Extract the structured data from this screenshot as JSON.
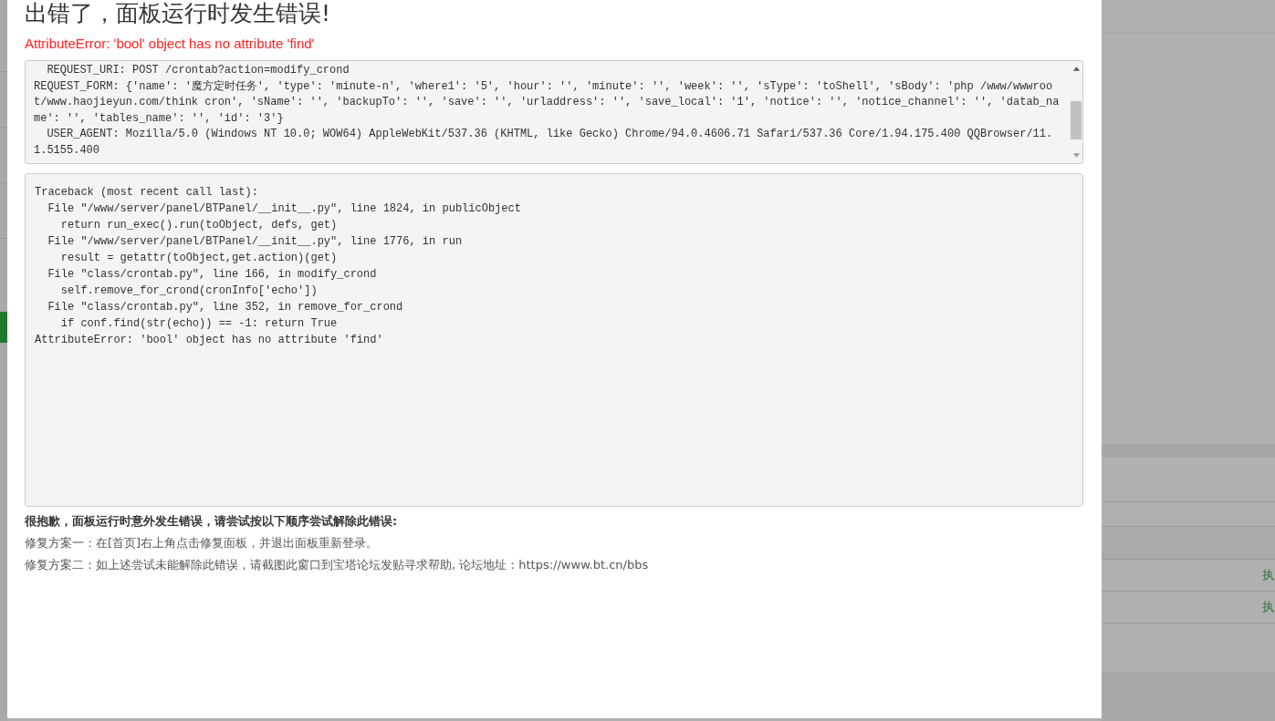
{
  "dialog": {
    "title": "出错了，面板运行时发生错误!",
    "error": "AttributeError: 'bool' object has no attribute 'find'",
    "request_info": "  REQUEST_URI: POST /crontab?action=modify_crond\nREQUEST_FORM: {'name': '魔方定时任务', 'type': 'minute-n', 'where1': '5', 'hour': '', 'minute': '', 'week': '', 'sType': 'toShell', 'sBody': 'php /www/wwwroo\nt/www.haojieyun.com/think cron', 'sName': '', 'backupTo': '', 'save': '', 'urladdress': '', 'save_local': '1', 'notice': '', 'notice_channel': '', 'datab_na\nme': '', 'tables_name': '', 'id': '3'}\n  USER_AGENT: Mozilla/5.0 (Windows NT 10.0; WOW64) AppleWebKit/537.36 (KHTML, like Gecko) Chrome/94.0.4606.71 Safari/537.36 Core/1.94.175.400 QQBrowser/11.\n1.5155.400",
    "traceback": "Traceback (most recent call last):\n  File \"/www/server/panel/BTPanel/__init__.py\", line 1824, in publicObject\n    return run_exec().run(toObject, defs, get)\n  File \"/www/server/panel/BTPanel/__init__.py\", line 1776, in run\n    result = getattr(toObject,get.action)(get)\n  File \"class/crontab.py\", line 166, in modify_crond\n    self.remove_for_crond(cronInfo['echo'])\n  File \"class/crontab.py\", line 352, in remove_for_crond\n    if conf.find(str(echo)) == -1: return True\nAttributeError: 'bool' object has no attribute 'find'",
    "help_heading": "很抱歉，面板运行时意外发生错误，请尝试按以下顺序尝试解除此错误:",
    "help_steps": [
      "修复方案一：在[首页]右上角点击修复面板，并退出面板重新登录。",
      "修复方案二：如上述尝试未能解除此错误，请截图此窗口到宝塔论坛发贴寻求帮助, 论坛地址：https://www.bt.cn/bbs"
    ]
  },
  "background": {
    "rows": [
      {
        "action": "执"
      },
      {
        "action": "执"
      }
    ]
  }
}
